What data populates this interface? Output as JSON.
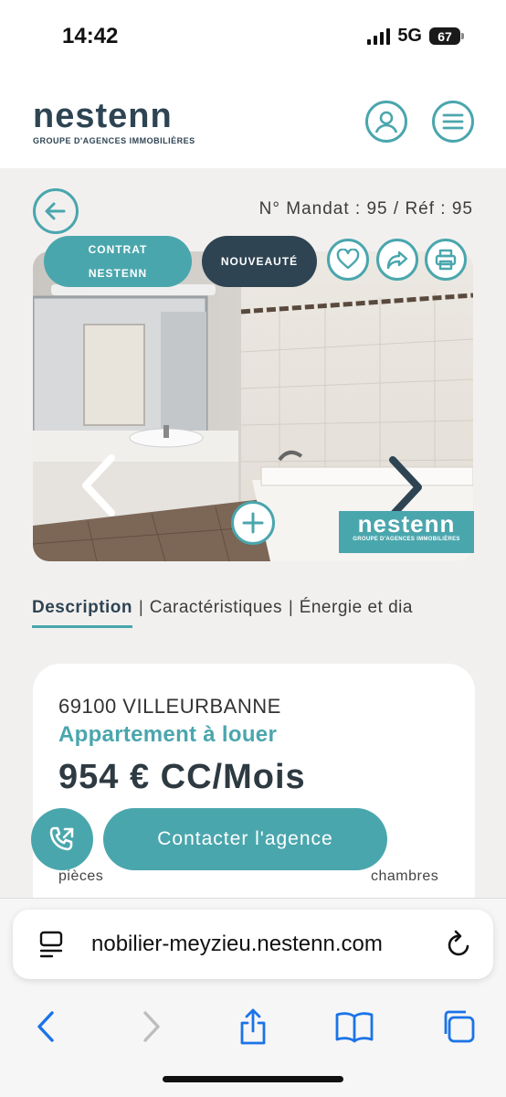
{
  "status_bar": {
    "time": "14:42",
    "network": "5G",
    "battery": "67"
  },
  "header": {
    "logo_text": "nestenn",
    "logo_subtitle": "GROUPE D'AGENCES IMMOBILIÈRES",
    "account_icon": "user-icon",
    "menu_icon": "hamburger-icon",
    "accent_color": "#4aa6ad",
    "brand_dark": "#2e4453"
  },
  "listing": {
    "mandat": "N° Mandat : 95 / Réf : 95",
    "badges": {
      "contrat_line1": "CONTRAT",
      "contrat_line2": "NESTENN",
      "nouveaute": "NOUVEAUTÉ"
    },
    "watermark": {
      "word": "nestenn",
      "subtitle": "GROUPE D'AGENCES IMMOBILIÈRES"
    }
  },
  "tabs": [
    {
      "label": "Description",
      "active": true
    },
    {
      "label": "Caractéristiques",
      "active": false
    },
    {
      "label": "Énergie et dia",
      "active": false
    }
  ],
  "card": {
    "city": "69100 VILLEURBANNE",
    "type": "Appartement à louer",
    "price": "954 € CC/Mois",
    "label_pieces": "pièces",
    "label_chambres": "chambres"
  },
  "actions": {
    "contact_label": "Contacter l'agence"
  },
  "browser": {
    "url": "nobilier-meyzieu.nestenn.com"
  }
}
